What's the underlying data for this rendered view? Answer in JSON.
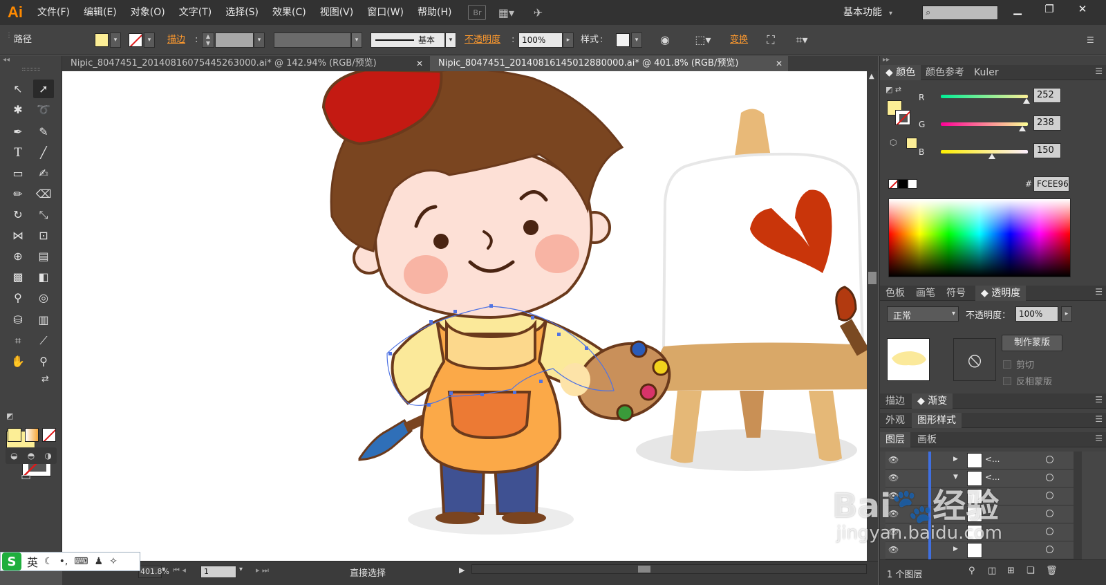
{
  "app": {
    "logo": "Ai",
    "workspace": "基本功能"
  },
  "menu": [
    "文件(F)",
    "编辑(E)",
    "对象(O)",
    "文字(T)",
    "选择(S)",
    "效果(C)",
    "视图(V)",
    "窗口(W)",
    "帮助(H)"
  ],
  "menu_extras": {
    "bridge": "Br",
    "arrange_icon": "arrange-documents-icon",
    "gpu_icon": "gpu-performance-icon"
  },
  "control": {
    "selection_type": "路径",
    "fill_color": "#FCEE96",
    "stroke_label": "描边",
    "profile_label": "基本",
    "opacity_label": "不透明度",
    "opacity_value": "100%",
    "style_label": "样式",
    "transform_label": "变换"
  },
  "tabs": [
    {
      "title": "Nipic_8047451_20140816075445263000.ai* @ 142.94% (RGB/预览)",
      "active": false
    },
    {
      "title": "Nipic_8047451_20140816145012880000.ai* @ 401.8% (RGB/预览)",
      "active": true
    }
  ],
  "status": {
    "tool_name": "直接选择",
    "zoom": "401.8%",
    "artboard": "1"
  },
  "ime": {
    "lang": "英"
  },
  "color_panel": {
    "tabs": [
      "颜色",
      "颜色参考",
      "Kuler"
    ],
    "channels": [
      {
        "name": "R",
        "value": "252",
        "fraction": 0.988
      },
      {
        "name": "G",
        "value": "238",
        "fraction": 0.933
      },
      {
        "name": "B",
        "value": "150",
        "fraction": 0.588
      }
    ],
    "hash_label": "#",
    "hex": "FCEE96"
  },
  "transparency_panel": {
    "tabs": [
      "色板",
      "画笔",
      "符号",
      "透明度"
    ],
    "blend_mode": "正常",
    "opacity_label": "不透明度：",
    "opacity_value": "100%",
    "make_mask": "制作蒙版",
    "clip": "剪切",
    "invert_mask": "反相蒙版"
  },
  "stroke_panel": {
    "tabs": [
      "描边",
      "渐变"
    ]
  },
  "appearance_panel": {
    "tabs": [
      "外观",
      "图形样式"
    ]
  },
  "layers_panel": {
    "tabs": [
      "图层",
      "画板"
    ],
    "rows": [
      {
        "name": "<...",
        "expanded": false
      },
      {
        "name": "<...",
        "expanded": true
      },
      {
        "name": "",
        "expanded": false
      },
      {
        "name": "",
        "expanded": false
      },
      {
        "name": "",
        "expanded": false
      },
      {
        "name": "",
        "expanded": false
      }
    ],
    "footer": "1 个图层"
  },
  "watermark": {
    "brand": "Bai",
    "brand2": "经验",
    "url": "jingyan.baidu.com"
  }
}
